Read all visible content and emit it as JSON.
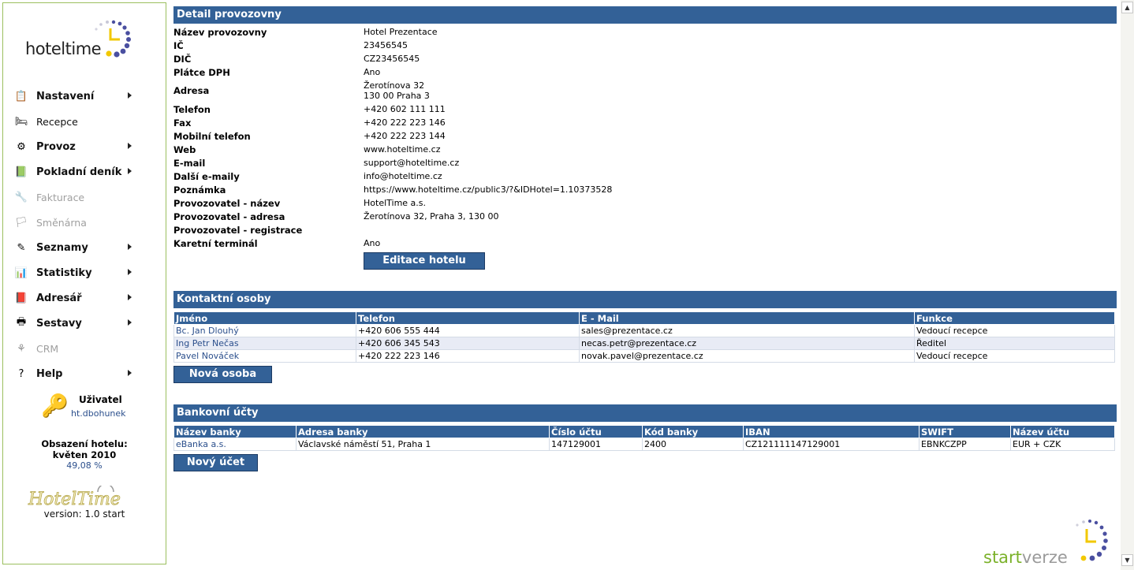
{
  "sidebar": {
    "logo_text": "hoteltime",
    "menu": [
      {
        "label": "Nastavení",
        "icon": "settings-icon",
        "glyph": "📋",
        "arrow": true,
        "state": "bold"
      },
      {
        "label": "Recepce",
        "icon": "reception-icon",
        "glyph": "🛏",
        "arrow": false,
        "state": "plain"
      },
      {
        "label": "Provoz",
        "icon": "operations-icon",
        "glyph": "⚙",
        "arrow": true,
        "state": "bold"
      },
      {
        "label": "Pokladní deník",
        "icon": "cash-book-icon",
        "glyph": "📗",
        "arrow": true,
        "state": "bold"
      },
      {
        "label": "Fakturace",
        "icon": "invoicing-icon",
        "glyph": "🔧",
        "arrow": false,
        "state": "disabled"
      },
      {
        "label": "Směnárna",
        "icon": "exchange-icon",
        "glyph": "🏳",
        "arrow": false,
        "state": "disabled"
      },
      {
        "label": "Seznamy",
        "icon": "lists-icon",
        "glyph": "✎",
        "arrow": true,
        "state": "bold"
      },
      {
        "label": "Statistiky",
        "icon": "statistics-icon",
        "glyph": "📊",
        "arrow": true,
        "state": "bold"
      },
      {
        "label": "Adresář",
        "icon": "address-book-icon",
        "glyph": "📕",
        "arrow": true,
        "state": "bold"
      },
      {
        "label": "Sestavy",
        "icon": "reports-icon",
        "glyph": "🖶",
        "arrow": true,
        "state": "bold"
      },
      {
        "label": "CRM",
        "icon": "crm-icon",
        "glyph": "⚘",
        "arrow": false,
        "state": "disabled"
      },
      {
        "label": "Help",
        "icon": "help-icon",
        "glyph": "?",
        "arrow": true,
        "state": "bold"
      }
    ],
    "user": {
      "title": "Uživatel",
      "name": "ht.dbohunek"
    },
    "occupancy": {
      "label": "Obsazení hotelu:",
      "period": "květen 2010",
      "value": "49,08 %"
    },
    "brand2_text": "HotelTime",
    "version": "version: 1.0 start"
  },
  "detail": {
    "header": "Detail provozovny",
    "rows": [
      {
        "label": "Název provozovny",
        "value": "Hotel Prezentace"
      },
      {
        "label": "IČ",
        "value": "23456545"
      },
      {
        "label": "DIČ",
        "value": "CZ23456545"
      },
      {
        "label": "Plátce DPH",
        "value": "Ano"
      },
      {
        "label": "Adresa",
        "value": "Žerotínova 32",
        "value2": "130 00  Praha 3"
      },
      {
        "label": "Telefon",
        "value": "+420 602 111 111"
      },
      {
        "label": "Fax",
        "value": "+420 222 223 146"
      },
      {
        "label": "Mobilní telefon",
        "value": "+420 222 223 144"
      },
      {
        "label": "Web",
        "value": "www.hoteltime.cz"
      },
      {
        "label": "E-mail",
        "value": "support@hoteltime.cz"
      },
      {
        "label": "Další e-maily",
        "value": "info@hoteltime.cz"
      },
      {
        "label": "Poznámka",
        "value": "https://www.hoteltime.cz/public3/?&IDHotel=1.10373528"
      },
      {
        "label": "Provozovatel - název",
        "value": "HotelTime a.s."
      },
      {
        "label": "Provozovatel - adresa",
        "value": "Žerotínova 32, Praha 3, 130 00"
      },
      {
        "label": "Provozovatel - registrace",
        "value": ""
      },
      {
        "label": "Karetní terminál",
        "value": "Ano"
      }
    ],
    "edit_button": "Editace hotelu"
  },
  "contacts": {
    "header": "Kontaktní osoby",
    "columns": [
      "Jméno",
      "Telefon",
      "E - Mail",
      "Funkce"
    ],
    "rows": [
      [
        "Bc. Jan Dlouhý",
        "+420 606 555 444",
        "sales@prezentace.cz",
        "Vedoucí recepce"
      ],
      [
        "Ing Petr Nečas",
        "+420 606 345 543",
        "necas.petr@prezentace.cz",
        "Ředitel"
      ],
      [
        "Pavel Nováček",
        "+420 222 223 146",
        "novak.pavel@prezentace.cz",
        "Vedoucí recepce"
      ]
    ],
    "new_button": "Nová osoba"
  },
  "banks": {
    "header": "Bankovní účty",
    "columns": [
      "Název banky",
      "Adresa banky",
      "Číslo účtu",
      "Kód banky",
      "IBAN",
      "SWIFT",
      "Název účtu"
    ],
    "rows": [
      [
        "eBanka a.s.",
        "Václavské náměstí 51, Praha 1",
        "147129001",
        "2400",
        "CZ121111147129001",
        "EBNKCZPP",
        "EUR + CZK"
      ]
    ],
    "new_button": "Nový účet"
  },
  "footer_brand": {
    "part1": "start",
    "part2": "verze"
  },
  "colors": {
    "header_bg": "#336197",
    "link": "#2b4f8c",
    "alt_row": "#e8ebf5",
    "sidebar_border": "#9bbf5f"
  }
}
